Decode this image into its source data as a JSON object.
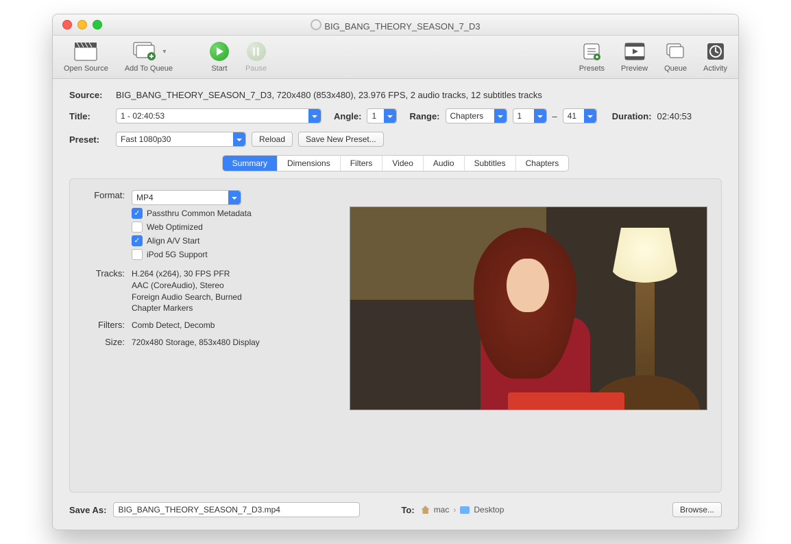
{
  "window": {
    "title": "BIG_BANG_THEORY_SEASON_7_D3"
  },
  "toolbar": {
    "open_source": "Open Source",
    "add_to_queue": "Add To Queue",
    "start": "Start",
    "pause": "Pause",
    "presets": "Presets",
    "preview": "Preview",
    "queue": "Queue",
    "activity": "Activity"
  },
  "source": {
    "label": "Source:",
    "value": "BIG_BANG_THEORY_SEASON_7_D3, 720x480 (853x480), 23.976 FPS, 2 audio tracks, 12 subtitles tracks"
  },
  "title_row": {
    "label": "Title:",
    "value": "1 - 02:40:53",
    "angle_label": "Angle:",
    "angle_value": "1",
    "range_label": "Range:",
    "range_type": "Chapters",
    "range_from": "1",
    "range_sep": "–",
    "range_to": "41",
    "duration_label": "Duration:",
    "duration_value": "02:40:53"
  },
  "preset_row": {
    "label": "Preset:",
    "value": "Fast 1080p30",
    "reload": "Reload",
    "save_new": "Save New Preset..."
  },
  "tabs": [
    "Summary",
    "Dimensions",
    "Filters",
    "Video",
    "Audio",
    "Subtitles",
    "Chapters"
  ],
  "summary": {
    "format_label": "Format:",
    "format_value": "MP4",
    "checks": {
      "passthru": {
        "label": "Passthru Common Metadata",
        "checked": true
      },
      "webopt": {
        "label": "Web Optimized",
        "checked": false
      },
      "align": {
        "label": "Align A/V Start",
        "checked": true
      },
      "ipod": {
        "label": "iPod 5G Support",
        "checked": false
      }
    },
    "tracks_label": "Tracks:",
    "tracks_lines": [
      "H.264 (x264), 30 FPS PFR",
      "AAC (CoreAudio), Stereo",
      "Foreign Audio Search, Burned",
      "Chapter Markers"
    ],
    "filters_label": "Filters:",
    "filters_value": "Comb Detect, Decomb",
    "size_label": "Size:",
    "size_value": "720x480 Storage, 853x480 Display"
  },
  "save": {
    "label": "Save As:",
    "filename": "BIG_BANG_THEORY_SEASON_7_D3.mp4",
    "to_label": "To:",
    "crumb_user": "mac",
    "crumb_folder": "Desktop",
    "browse": "Browse..."
  }
}
